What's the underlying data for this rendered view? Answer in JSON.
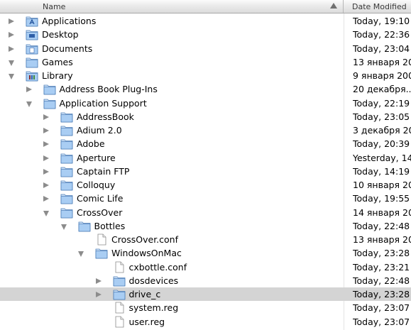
{
  "header": {
    "name_label": "Name",
    "date_label": "Date Modified"
  },
  "rows": [
    {
      "name": "Applications",
      "date": "Today, 19:10",
      "depth": 0,
      "disc": "right",
      "icon": "applications-folder-icon"
    },
    {
      "name": "Desktop",
      "date": "Today, 22:36",
      "depth": 0,
      "disc": "right",
      "icon": "desktop-folder-icon"
    },
    {
      "name": "Documents",
      "date": "Today, 23:04",
      "depth": 0,
      "disc": "right",
      "icon": "documents-folder-icon"
    },
    {
      "name": "Games",
      "date": "13 января 20",
      "depth": 0,
      "disc": "down",
      "icon": "folder-icon"
    },
    {
      "name": "Library",
      "date": "9 января 200",
      "depth": 0,
      "disc": "down",
      "icon": "library-folder-icon"
    },
    {
      "name": "Address Book Plug-Ins",
      "date": "20 декабря...",
      "depth": 1,
      "disc": "right",
      "icon": "folder-icon"
    },
    {
      "name": "Application Support",
      "date": "Today, 22:19",
      "depth": 1,
      "disc": "down",
      "icon": "folder-icon"
    },
    {
      "name": "AddressBook",
      "date": "Today, 23:05",
      "depth": 2,
      "disc": "right",
      "icon": "folder-icon"
    },
    {
      "name": "Adium 2.0",
      "date": "3 декабря 20",
      "depth": 2,
      "disc": "right",
      "icon": "folder-icon"
    },
    {
      "name": "Adobe",
      "date": "Today, 20:39",
      "depth": 2,
      "disc": "right",
      "icon": "folder-icon"
    },
    {
      "name": "Aperture",
      "date": "Yesterday, 14",
      "depth": 2,
      "disc": "right",
      "icon": "folder-icon"
    },
    {
      "name": "Captain FTP",
      "date": "Today, 14:19",
      "depth": 2,
      "disc": "right",
      "icon": "folder-icon"
    },
    {
      "name": "Colloquy",
      "date": "10 января 20",
      "depth": 2,
      "disc": "right",
      "icon": "folder-icon"
    },
    {
      "name": "Comic Life",
      "date": "Today, 19:55",
      "depth": 2,
      "disc": "right",
      "icon": "folder-icon"
    },
    {
      "name": "CrossOver",
      "date": "14 января 20",
      "depth": 2,
      "disc": "down",
      "icon": "folder-icon"
    },
    {
      "name": "Bottles",
      "date": "Today, 22:48",
      "depth": 3,
      "disc": "down",
      "icon": "folder-icon"
    },
    {
      "name": "CrossOver.conf",
      "date": "13 января 20",
      "depth": 4,
      "disc": "none",
      "icon": "document-icon"
    },
    {
      "name": "WindowsOnMac",
      "date": "Today, 23:28",
      "depth": 4,
      "disc": "down",
      "icon": "folder-icon"
    },
    {
      "name": "cxbottle.conf",
      "date": "Today, 23:21",
      "depth": 5,
      "disc": "none",
      "icon": "document-icon"
    },
    {
      "name": "dosdevices",
      "date": "Today, 22:48",
      "depth": 5,
      "disc": "right",
      "icon": "folder-icon"
    },
    {
      "name": "drive_c",
      "date": "Today, 23:28",
      "depth": 5,
      "disc": "right",
      "icon": "folder-icon",
      "selected": true
    },
    {
      "name": "system.reg",
      "date": "Today, 23:07",
      "depth": 5,
      "disc": "none",
      "icon": "document-icon"
    },
    {
      "name": "user.reg",
      "date": "Today, 23:07",
      "depth": 5,
      "disc": "none",
      "icon": "document-icon"
    }
  ]
}
